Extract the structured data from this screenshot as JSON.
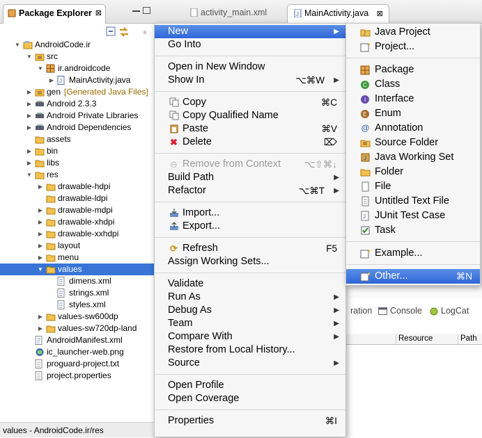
{
  "explorer": {
    "tab_label": "Package Explorer",
    "close_glyph": "⊠",
    "tree": [
      {
        "label": "AndroidCode.ir",
        "level": 0,
        "twisty": "open",
        "icon": "project-icon"
      },
      {
        "label": "src",
        "level": 1,
        "twisty": "open",
        "icon": "source-folder-icon"
      },
      {
        "label": "ir.androidcode",
        "level": 2,
        "twisty": "open",
        "icon": "package-icon"
      },
      {
        "label": "MainActivity.java",
        "level": 3,
        "twisty": "closed",
        "icon": "java-file-icon"
      },
      {
        "label": "gen",
        "level": 1,
        "twisty": "closed",
        "icon": "source-folder-icon",
        "decoration": "[Generated Java Files]"
      },
      {
        "label": "Android 2.3.3",
        "level": 1,
        "twisty": "closed",
        "icon": "library-icon"
      },
      {
        "label": "Android Private Libraries",
        "level": 1,
        "twisty": "closed",
        "icon": "library-icon"
      },
      {
        "label": "Android Dependencies",
        "level": 1,
        "twisty": "closed",
        "icon": "library-icon"
      },
      {
        "label": "assets",
        "level": 1,
        "twisty": "none",
        "icon": "folder-icon"
      },
      {
        "label": "bin",
        "level": 1,
        "twisty": "closed",
        "icon": "folder-icon"
      },
      {
        "label": "libs",
        "level": 1,
        "twisty": "closed",
        "icon": "folder-icon"
      },
      {
        "label": "res",
        "level": 1,
        "twisty": "open",
        "icon": "folder-icon"
      },
      {
        "label": "drawable-hdpi",
        "level": 2,
        "twisty": "closed",
        "icon": "folder-icon"
      },
      {
        "label": "drawable-ldpi",
        "level": 2,
        "twisty": "none",
        "icon": "folder-icon"
      },
      {
        "label": "drawable-mdpi",
        "level": 2,
        "twisty": "closed",
        "icon": "folder-icon"
      },
      {
        "label": "drawable-xhdpi",
        "level": 2,
        "twisty": "closed",
        "icon": "folder-icon"
      },
      {
        "label": "drawable-xxhdpi",
        "level": 2,
        "twisty": "closed",
        "icon": "folder-icon"
      },
      {
        "label": "layout",
        "level": 2,
        "twisty": "closed",
        "icon": "folder-icon"
      },
      {
        "label": "menu",
        "level": 2,
        "twisty": "closed",
        "icon": "folder-icon"
      },
      {
        "label": "values",
        "level": 2,
        "twisty": "open",
        "icon": "folder-icon",
        "selected": true
      },
      {
        "label": "dimens.xml",
        "level": 3,
        "twisty": "none",
        "icon": "xml-file-icon"
      },
      {
        "label": "strings.xml",
        "level": 3,
        "twisty": "none",
        "icon": "xml-file-icon"
      },
      {
        "label": "styles.xml",
        "level": 3,
        "twisty": "none",
        "icon": "xml-file-icon"
      },
      {
        "label": "values-sw600dp",
        "level": 2,
        "twisty": "closed",
        "icon": "folder-icon"
      },
      {
        "label": "values-sw720dp-land",
        "level": 2,
        "twisty": "closed",
        "icon": "folder-icon"
      },
      {
        "label": "AndroidManifest.xml",
        "level": 1,
        "twisty": "none",
        "icon": "xml-file-icon"
      },
      {
        "label": "ic_launcher-web.png",
        "level": 1,
        "twisty": "none",
        "icon": "image-file-icon"
      },
      {
        "label": "proguard-project.txt",
        "level": 1,
        "twisty": "none",
        "icon": "text-file-icon"
      },
      {
        "label": "project.properties",
        "level": 1,
        "twisty": "none",
        "icon": "text-file-icon"
      }
    ]
  },
  "status_bar": {
    "text": "values - AndroidCode.ir/res"
  },
  "editor": {
    "tabs": [
      {
        "label": "activity_main.xml",
        "active": false
      },
      {
        "label": "MainActivity.java",
        "active": true
      }
    ]
  },
  "bottom_panel": {
    "tabs": [
      "ration",
      "Console",
      "LogCat"
    ],
    "columns": [
      "Resource",
      "Path"
    ]
  },
  "context_menu": {
    "items": [
      {
        "label": "New",
        "submenu": true,
        "highlight": true
      },
      {
        "label": "Go Into"
      },
      {
        "sep": true
      },
      {
        "label": "Open in New Window"
      },
      {
        "label": "Show In",
        "shortcut": "⌥⌘W",
        "submenu": true
      },
      {
        "sep": true
      },
      {
        "label": "Copy",
        "shortcut": "⌘C",
        "icon": "copy-icon"
      },
      {
        "label": "Copy Qualified Name",
        "icon": "copy-qualified-icon"
      },
      {
        "label": "Paste",
        "shortcut": "⌘V",
        "icon": "paste-icon"
      },
      {
        "label": "Delete",
        "shortcut": "⌦",
        "icon": "delete-icon"
      },
      {
        "sep": true
      },
      {
        "label": "Remove from Context",
        "shortcut": "⌥⇧⌘↓",
        "icon": "remove-context-icon",
        "disabled": true
      },
      {
        "label": "Build Path",
        "submenu": true
      },
      {
        "label": "Refactor",
        "shortcut": "⌥⌘T",
        "submenu": true
      },
      {
        "sep": true
      },
      {
        "label": "Import...",
        "icon": "import-icon"
      },
      {
        "label": "Export...",
        "icon": "export-icon"
      },
      {
        "sep": true
      },
      {
        "label": "Refresh",
        "shortcut": "F5",
        "icon": "refresh-icon"
      },
      {
        "label": "Assign Working Sets..."
      },
      {
        "sep": true
      },
      {
        "label": "Validate"
      },
      {
        "label": "Run As",
        "submenu": true
      },
      {
        "label": "Debug As",
        "submenu": true
      },
      {
        "label": "Team",
        "submenu": true
      },
      {
        "label": "Compare With",
        "submenu": true
      },
      {
        "label": "Restore from Local History..."
      },
      {
        "label": "Source",
        "submenu": true
      },
      {
        "sep": true
      },
      {
        "label": "Open Profile"
      },
      {
        "label": "Open Coverage"
      },
      {
        "sep": true
      },
      {
        "label": "Properties",
        "shortcut": "⌘I"
      }
    ]
  },
  "new_submenu": {
    "items": [
      {
        "label": "Java Project",
        "icon": "java-project-icon"
      },
      {
        "label": "Project...",
        "icon": "project-wizard-icon"
      },
      {
        "sep": true
      },
      {
        "label": "Package",
        "icon": "package-icon"
      },
      {
        "label": "Class",
        "icon": "class-icon"
      },
      {
        "label": "Interface",
        "icon": "interface-icon"
      },
      {
        "label": "Enum",
        "icon": "enum-icon"
      },
      {
        "label": "Annotation",
        "icon": "annotation-icon"
      },
      {
        "label": "Source Folder",
        "icon": "source-folder-icon"
      },
      {
        "label": "Java Working Set",
        "icon": "working-set-icon"
      },
      {
        "label": "Folder",
        "icon": "folder-icon"
      },
      {
        "label": "File",
        "icon": "file-icon"
      },
      {
        "label": "Untitled Text File",
        "icon": "text-file-icon"
      },
      {
        "label": "JUnit Test Case",
        "icon": "junit-icon"
      },
      {
        "label": "Task",
        "icon": "task-icon"
      },
      {
        "sep": true
      },
      {
        "label": "Example...",
        "icon": "example-icon"
      },
      {
        "sep": true
      },
      {
        "label": "Other...",
        "shortcut": "⌘N",
        "icon": "other-wizard-icon",
        "highlight": true
      }
    ]
  },
  "colors": {
    "selection": "#3875d7",
    "menu_highlight": "#2f66d8"
  }
}
